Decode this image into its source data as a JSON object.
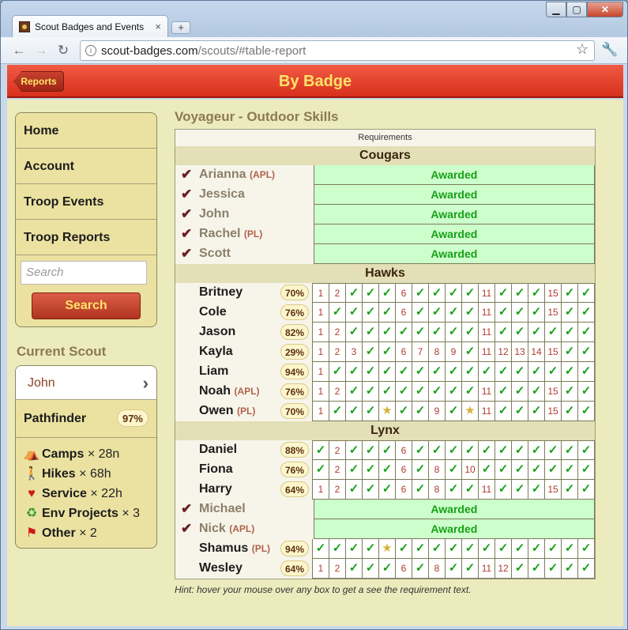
{
  "browser": {
    "tab_title": "Scout Badges and Events",
    "tab_close": "×",
    "new_tab": "+",
    "window_min": "▁",
    "window_max": "▢",
    "window_close": "✕",
    "url_host": "scout-badges.com",
    "url_path": "/scouts/#table-report"
  },
  "appbar": {
    "back_label": "Reports",
    "title": "By Badge"
  },
  "sidebar": {
    "menu": [
      "Home",
      "Account",
      "Troop Events",
      "Troop Reports"
    ],
    "search_placeholder": "Search",
    "search_button": "Search",
    "current_scout_heading": "Current Scout",
    "scout_name": "John",
    "rank": "Pathfinder",
    "rank_pct": "97%",
    "activities": [
      {
        "icon": "tent-icon",
        "label": "Camps",
        "value": "× 28n"
      },
      {
        "icon": "hiker-icon",
        "label": "Hikes",
        "value": "× 68h"
      },
      {
        "icon": "heart-icon",
        "label": "Service",
        "value": "× 22h"
      },
      {
        "icon": "recycle-icon",
        "label": "Env Projects",
        "value": "× 3"
      },
      {
        "icon": "flag-icon",
        "label": "Other",
        "value": "× 2"
      }
    ]
  },
  "main": {
    "badge_title": "Voyageur - Outdoor Skills",
    "requirements_label": "Requirements",
    "hint": "Hint: hover your mouse over any box to get a see the requirement text.",
    "awarded_label": "Awarded",
    "groups": [
      {
        "name": "Cougars",
        "scouts": [
          {
            "name": "Arianna",
            "role": "(APL)",
            "awarded": true
          },
          {
            "name": "Jessica",
            "role": "",
            "awarded": true
          },
          {
            "name": "John",
            "role": "",
            "awarded": true
          },
          {
            "name": "Rachel",
            "role": "(PL)",
            "awarded": true
          },
          {
            "name": "Scott",
            "role": "",
            "awarded": true
          }
        ]
      },
      {
        "name": "Hawks",
        "scouts": [
          {
            "name": "Britney",
            "role": "",
            "awarded": false,
            "pct": "70%",
            "cells": [
              "1",
              "2",
              "✓",
              "✓",
              "✓",
              "6",
              "✓",
              "✓",
              "✓",
              "✓",
              "11",
              "✓",
              "✓",
              "✓",
              "15",
              "✓",
              "✓"
            ]
          },
          {
            "name": "Cole",
            "role": "",
            "awarded": false,
            "pct": "76%",
            "cells": [
              "1",
              "✓",
              "✓",
              "✓",
              "✓",
              "6",
              "✓",
              "✓",
              "✓",
              "✓",
              "11",
              "✓",
              "✓",
              "✓",
              "15",
              "✓",
              "✓"
            ]
          },
          {
            "name": "Jason",
            "role": "",
            "awarded": false,
            "pct": "82%",
            "cells": [
              "1",
              "2",
              "✓",
              "✓",
              "✓",
              "✓",
              "✓",
              "✓",
              "✓",
              "✓",
              "11",
              "✓",
              "✓",
              "✓",
              "✓",
              "✓",
              "✓"
            ]
          },
          {
            "name": "Kayla",
            "role": "",
            "awarded": false,
            "pct": "29%",
            "cells": [
              "1",
              "2",
              "3",
              "✓",
              "✓",
              "6",
              "7",
              "8",
              "9",
              "✓",
              "11",
              "12",
              "13",
              "14",
              "15",
              "✓",
              "✓"
            ]
          },
          {
            "name": "Liam",
            "role": "",
            "awarded": false,
            "pct": "94%",
            "cells": [
              "1",
              "✓",
              "✓",
              "✓",
              "✓",
              "✓",
              "✓",
              "✓",
              "✓",
              "✓",
              "✓",
              "✓",
              "✓",
              "✓",
              "✓",
              "✓",
              "✓"
            ]
          },
          {
            "name": "Noah",
            "role": "(APL)",
            "awarded": false,
            "pct": "76%",
            "cells": [
              "1",
              "2",
              "✓",
              "✓",
              "✓",
              "✓",
              "✓",
              "✓",
              "✓",
              "✓",
              "11",
              "✓",
              "✓",
              "✓",
              "15",
              "✓",
              "✓"
            ]
          },
          {
            "name": "Owen",
            "role": "(PL)",
            "awarded": false,
            "pct": "70%",
            "cells": [
              "1",
              "✓",
              "✓",
              "✓",
              "★",
              "✓",
              "✓",
              "9",
              "✓",
              "★",
              "11",
              "✓",
              "✓",
              "✓",
              "15",
              "✓",
              "✓"
            ]
          }
        ]
      },
      {
        "name": "Lynx",
        "scouts": [
          {
            "name": "Daniel",
            "role": "",
            "awarded": false,
            "pct": "88%",
            "cells": [
              "✓",
              "2",
              "✓",
              "✓",
              "✓",
              "6",
              "✓",
              "✓",
              "✓",
              "✓",
              "✓",
              "✓",
              "✓",
              "✓",
              "✓",
              "✓",
              "✓"
            ]
          },
          {
            "name": "Fiona",
            "role": "",
            "awarded": false,
            "pct": "76%",
            "cells": [
              "✓",
              "2",
              "✓",
              "✓",
              "✓",
              "6",
              "✓",
              "8",
              "✓",
              "10",
              "✓",
              "✓",
              "✓",
              "✓",
              "✓",
              "✓",
              "✓"
            ]
          },
          {
            "name": "Harry",
            "role": "",
            "awarded": false,
            "pct": "64%",
            "cells": [
              "1",
              "2",
              "✓",
              "✓",
              "✓",
              "6",
              "✓",
              "8",
              "✓",
              "✓",
              "11",
              "✓",
              "✓",
              "✓",
              "15",
              "✓",
              "✓"
            ]
          },
          {
            "name": "Michael",
            "role": "",
            "awarded": true
          },
          {
            "name": "Nick",
            "role": "(APL)",
            "awarded": true
          },
          {
            "name": "Shamus",
            "role": "(PL)",
            "awarded": false,
            "pct": "94%",
            "cells": [
              "✓",
              "✓",
              "✓",
              "✓",
              "★",
              "✓",
              "✓",
              "✓",
              "✓",
              "✓",
              "✓",
              "✓",
              "✓",
              "✓",
              "✓",
              "✓",
              "✓"
            ]
          },
          {
            "name": "Wesley",
            "role": "",
            "awarded": false,
            "pct": "64%",
            "cells": [
              "1",
              "2",
              "✓",
              "✓",
              "✓",
              "6",
              "✓",
              "8",
              "✓",
              "✓",
              "11",
              "12",
              "✓",
              "✓",
              "✓",
              "✓",
              "✓"
            ]
          }
        ]
      }
    ]
  }
}
